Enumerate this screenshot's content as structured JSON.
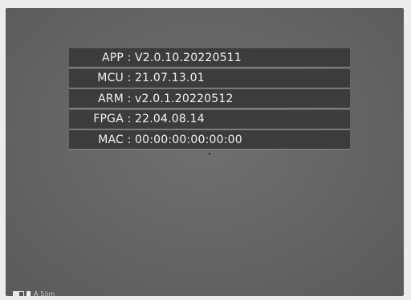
{
  "info": {
    "rows": [
      {
        "label": "APP",
        "colon": ":",
        "value": "V2.0.10.20220511"
      },
      {
        "label": "MCU",
        "colon": ":",
        "value": "21.07.13.01"
      },
      {
        "label": "ARM",
        "colon": ":",
        "value": "v2.0.1.20220512"
      },
      {
        "label": "FPGA",
        "colon": ":",
        "value": "22.04.08.14"
      },
      {
        "label": "MAC",
        "colon": ":",
        "value": "00:00:00:00:00:00"
      }
    ]
  },
  "status_bar": {
    "icons": [
      "battery-icon",
      "mode-icon"
    ],
    "text": "A 5lim"
  },
  "colors": {
    "screen_background": "#646464",
    "row_background": "#3c3c3c",
    "text": "#f2f2f2"
  }
}
